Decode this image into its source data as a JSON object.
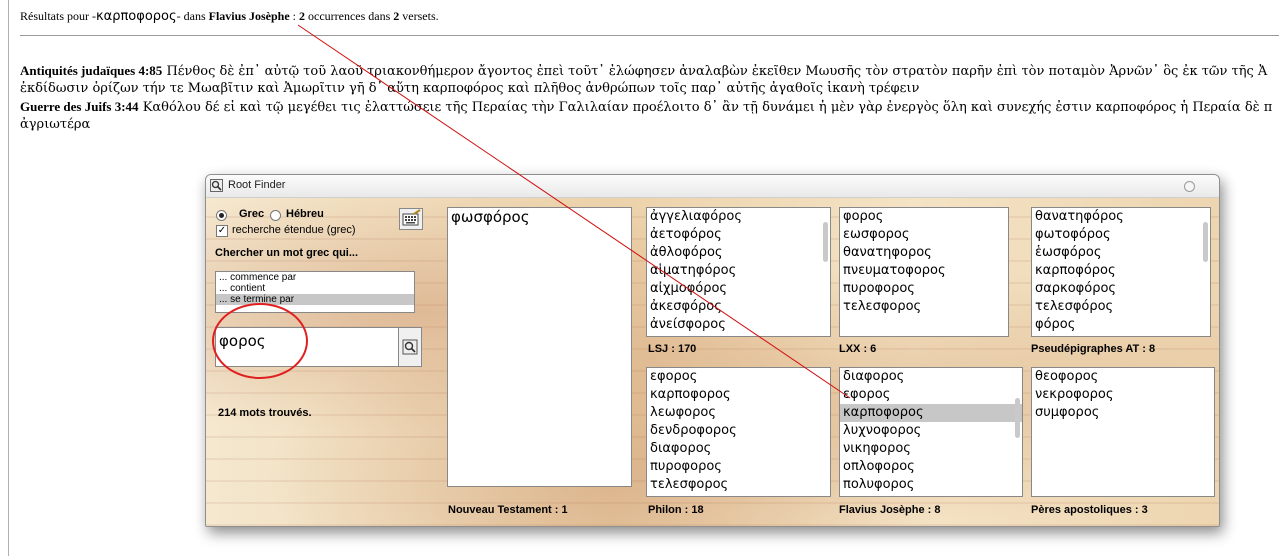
{
  "header": {
    "prefix": "Résultats pour -",
    "query": "καρποφορος",
    "mid": "- dans ",
    "corpus": "Flavius Josèphe",
    "sep": " : ",
    "occ_count": "2",
    "occ_text": " occurrences dans ",
    "verse_count": "2",
    "verse_text": " versets."
  },
  "results": [
    {
      "ref": "Antiquités judaïques 4:85",
      "text": " Πένθος δὲ ἐπ᾽ αὐτῷ τοῦ λαοῦ τριακονθήμερον ἄγοντος ἐπεὶ τοῦτ᾽ ἐλώφησεν ἀναλαβὼν ἐκεῖθεν Μωυσῆς τὸν στρατὸν παρῆν ἐπὶ τὸν ποταμὸν Ἀρνῶν᾽ ὃς ἐκ τῶν τῆς Ἀ",
      "cont": "ἐκδίδωσιν ὁρίζων τήν τε Μωαβῖτιν καὶ Ἀμωρῖτιν γῆ δ᾽ αὕτη καρποφόρος καὶ πλῆθος ἀνθρώπων τοῖς παρ᾽ αὐτῆς ἀγαθοῖς ἱκανὴ τρέφειν"
    },
    {
      "ref": "Guerre des Juifs 3:44",
      "text": " Καθόλου δέ εἰ καὶ τῷ μεγέθει τις ἐλαττώσειε τῆς Περαίας τὴν Γαλιλαίαν προέλοιτο δ᾽ ἂν τῇ δυνάμει ἡ μὲν γὰρ ἐνεργὸς ὅλη καὶ συνεχής ἐστιν καρποφόρος ἡ Περαία δὲ π",
      "cont": "ἀγριωτέρα"
    }
  ],
  "dialog": {
    "title": "Root Finder",
    "lang_grec": "Grec",
    "lang_hebreu": "Hébreu",
    "extended": "recherche étendue (grec)",
    "search_heading": "Chercher un mot grec qui...",
    "modes": [
      "... commence par",
      "... contient",
      "... se termine par"
    ],
    "selected_mode": 2,
    "search_value": "φορος",
    "found": "214 mots trouvés.",
    "main_list": [
      "φωσφόρος"
    ],
    "panels": [
      {
        "label": "LSJ :  170",
        "words": [
          "ἀγγελιαφόρος",
          "ἀετοφόρος",
          "ἀθλοφόρος",
          "αἱματηφόρος",
          "αἰχμοφόρος",
          "ἀκεσφόρος",
          "ἀνείσφορος"
        ]
      },
      {
        "label": "LXX :  6",
        "words": [
          "φορος",
          "εωσφορος",
          "θανατηφορος",
          "πνευματοφορος",
          "πυροφορος",
          "τελεσφορος"
        ]
      },
      {
        "label": "Pseudépigraphes AT :  8",
        "words": [
          "θανατηφόρος",
          "φωτοφόρος",
          "ἑωσφόρος",
          "καρποφόρος",
          "σαρκοφόρος",
          "τελεσφόρος",
          "φόρος"
        ]
      },
      {
        "label": "Philon :  18",
        "words": [
          "εφορος",
          "καρποφορος",
          "λεωφορος",
          "δενδροφορος",
          "διαφορος",
          "πυροφορος",
          "τελεσφορος"
        ]
      },
      {
        "label": "Flavius Josèphe :  8",
        "words": [
          "διαφορος",
          "εφορος",
          "καρποφορος",
          "λυχνοφορος",
          "νικηφορος",
          "οπλοφορος",
          "πολυφορος"
        ],
        "selected": 2
      },
      {
        "label": "Pères apostoliques :  3",
        "words": [
          "θεοφορος",
          "νεκροφορος",
          "συμφορος"
        ]
      }
    ],
    "nt_label": "Nouveau Testament :  1"
  }
}
